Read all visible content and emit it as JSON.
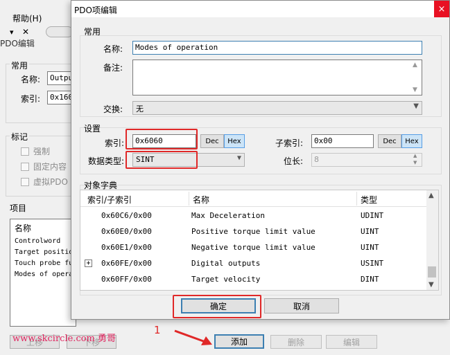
{
  "background_window": {
    "menu_help": "帮助(H)",
    "title": "PDO编辑",
    "general_group": "常用",
    "name_label": "名称:",
    "name_value": "Outpu",
    "index_label": "索引:",
    "index_value": "0x160",
    "flags_group": "标记",
    "flag_mandatory": "强制",
    "flag_fixed_content": "固定内容",
    "flag_virtual_pdo": "虚拟PDO",
    "items_group": "项目",
    "list_header": "名称",
    "list_rows": [
      "Controlword",
      "Target positio",
      "Touch probe fu",
      "Modes of opera"
    ],
    "btn_move_up": "上移",
    "btn_move_down": "下移",
    "btn_add": "添加",
    "btn_delete": "删除",
    "btn_edit": "编辑"
  },
  "dialog": {
    "title": "PDO项编辑",
    "close_label": "×",
    "general": {
      "group_title": "常用",
      "name_label": "名称:",
      "name_value": "Modes of operation",
      "comment_label": "备注:",
      "comment_value": "",
      "exchange_label": "交换:",
      "exchange_value": "无"
    },
    "settings": {
      "group_title": "设置",
      "index_label": "索引:",
      "index_value": "0x6060",
      "dec_label": "Dec",
      "hex_label": "Hex",
      "subindex_label": "子索引:",
      "subindex_value": "0x00",
      "datatype_label": "数据类型:",
      "datatype_value": "SINT",
      "bitlen_label": "位长:",
      "bitlen_value": "8"
    },
    "object_dictionary": {
      "group_title": "对象字典",
      "columns": [
        "索引/子索引",
        "名称",
        "类型"
      ],
      "rows": [
        {
          "index": "0x60C6/0x00",
          "name": "Max Deceleration",
          "type": "UDINT"
        },
        {
          "index": "0x60E0/0x00",
          "name": "Positive torque limit value",
          "type": "UINT"
        },
        {
          "index": "0x60E1/0x00",
          "name": "Negative torque limit value",
          "type": "UINT"
        },
        {
          "index": "0x60FE/0x00",
          "name": "Digital outputs",
          "type": "USINT",
          "expander": "+"
        },
        {
          "index": "0x60FF/0x00",
          "name": "Target velocity",
          "type": "DINT"
        }
      ]
    },
    "ok_label": "确定",
    "cancel_label": "取消"
  },
  "annotation": {
    "watermark": "www.skcircle.com 勇哥",
    "step_number": "1",
    "highlight_color": "#e02828"
  },
  "icons": {
    "combo_arrow": "chevron-down-icon",
    "close": "close-icon",
    "arrow": "annotation-arrow"
  }
}
